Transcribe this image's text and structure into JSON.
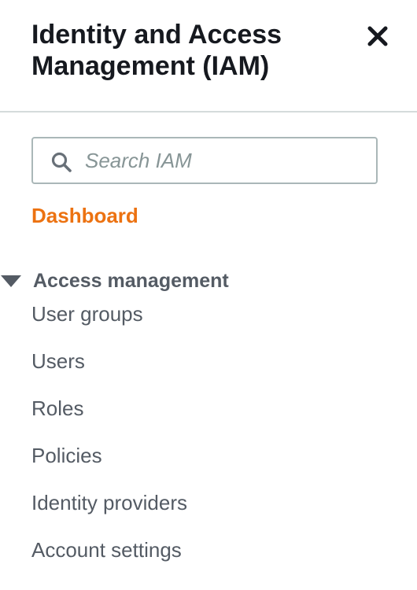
{
  "header": {
    "title": "Identity and Access Management (IAM)",
    "close_icon": "close-icon"
  },
  "search": {
    "placeholder": "Search IAM",
    "value": "",
    "icon": "search-icon"
  },
  "dashboard": {
    "label": "Dashboard",
    "color": "#ec7211"
  },
  "section": {
    "title": "Access management",
    "expanded": true,
    "icon": "caret-down-icon",
    "items": [
      {
        "label": "User groups"
      },
      {
        "label": "Users"
      },
      {
        "label": "Roles"
      },
      {
        "label": "Policies"
      },
      {
        "label": "Identity providers"
      },
      {
        "label": "Account settings"
      }
    ]
  }
}
